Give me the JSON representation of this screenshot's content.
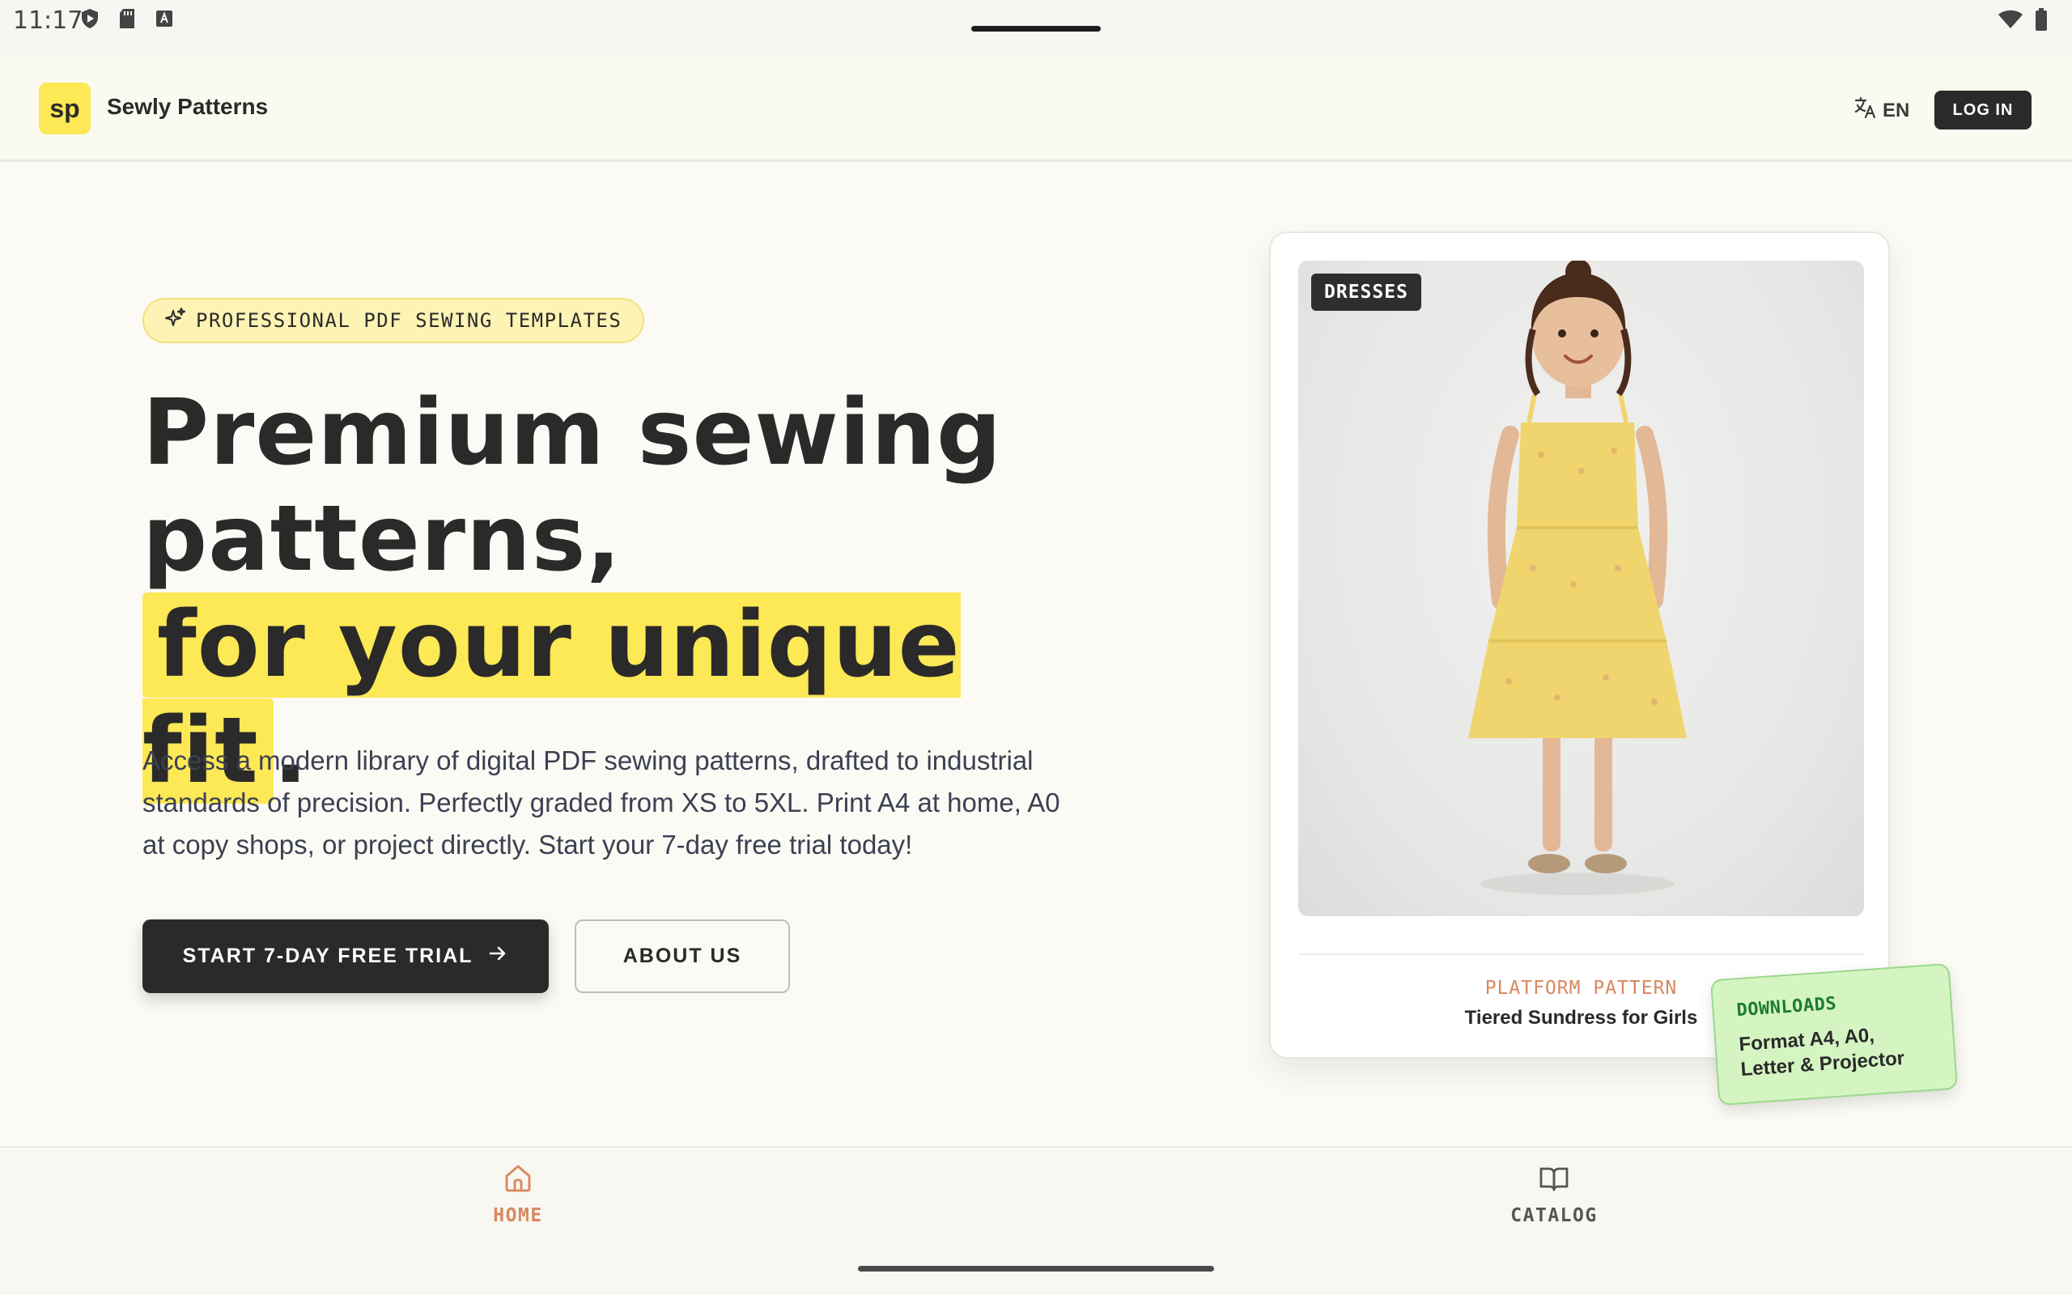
{
  "status_bar": {
    "time": "11:17"
  },
  "header": {
    "logo_text": "sp",
    "brand_name": "Sewly Patterns",
    "language": "EN",
    "login_label": "LOG IN"
  },
  "hero": {
    "chip_text": "PROFESSIONAL PDF SEWING TEMPLATES",
    "title_line1": "Premium sewing",
    "title_line2": "patterns,",
    "title_highlight": "for your unique fit",
    "title_end": ".",
    "description": "Access a modern library of digital PDF sewing patterns, drafted to industrial standards of precision. Perfectly graded from XS to 5XL. Print A4 at home, A0 at copy shops, or project directly. Start your 7-day free trial today!",
    "primary_cta": "START 7-DAY FREE TRIAL",
    "secondary_cta": "ABOUT US"
  },
  "product_card": {
    "category": "DRESSES",
    "kicker": "PLATFORM PATTERN",
    "name": "Tiered Sundress for Girls"
  },
  "downloads": {
    "title": "DOWNLOADS",
    "body": "Format A4, A0, Letter & Projector"
  },
  "bottom_nav": {
    "items": [
      {
        "label": "HOME",
        "icon": "home-icon",
        "active": true
      },
      {
        "label": "CATALOG",
        "icon": "book-icon",
        "active": false
      }
    ]
  },
  "colors": {
    "accent_yellow": "#fde855",
    "dark": "#2a2a2a",
    "accent_orange": "#d8875e",
    "sticker_green": "#d4f5c2"
  }
}
